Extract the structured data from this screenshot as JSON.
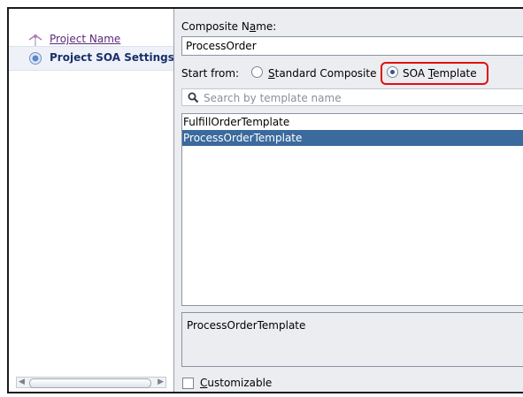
{
  "nav": {
    "items": [
      {
        "label": "Project Name",
        "state": "link"
      },
      {
        "label": "Project SOA Settings",
        "state": "current"
      }
    ]
  },
  "form": {
    "composite_label_pre": "Composite N",
    "composite_label_mnemonic": "a",
    "composite_label_post": "me:",
    "composite_value": "ProcessOrder",
    "start_from_label": "Start from:",
    "radio_standard_mnemonic": "S",
    "radio_standard_rest": "tandard Composite",
    "radio_soa_pre": "SOA ",
    "radio_soa_mnemonic": "T",
    "radio_soa_rest": "emplate",
    "selected_option": "SOA Template",
    "search_placeholder": "Search by template name",
    "templates": [
      "FulfillOrderTemplate",
      "ProcessOrderTemplate"
    ],
    "selected_template": "ProcessOrderTemplate",
    "description": "ProcessOrderTemplate",
    "customizable_mnemonic": "C",
    "customizable_rest": "ustomizable",
    "customizable_checked": false
  },
  "colors": {
    "selection": "#3b6a9c",
    "highlight_box": "#e01010",
    "nav_link": "#5a2a7a",
    "nav_current": "#1a2f6a"
  }
}
